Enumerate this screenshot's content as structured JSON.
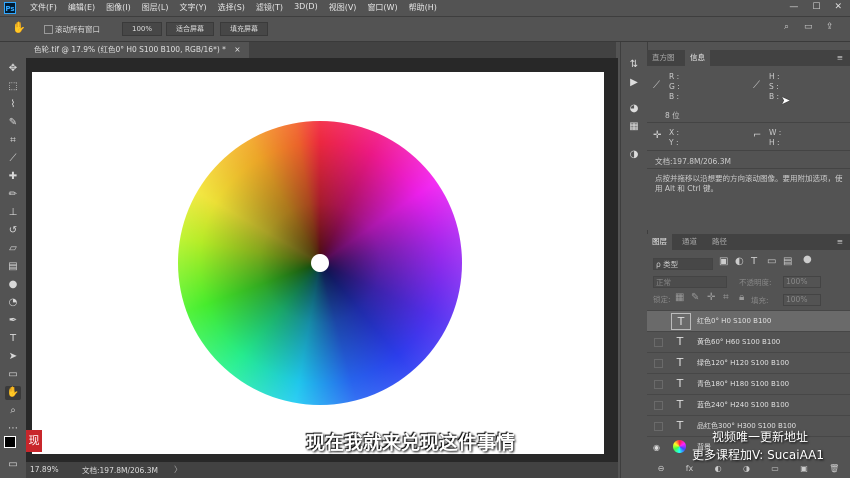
{
  "menubar": {
    "logo": "Ps",
    "items": [
      "文件(F)",
      "编辑(E)",
      "图像(I)",
      "图层(L)",
      "文字(Y)",
      "选择(S)",
      "滤镜(T)",
      "3D(D)",
      "视图(V)",
      "窗口(W)",
      "帮助(H)"
    ],
    "window_controls": [
      "—",
      "☐",
      "✕"
    ]
  },
  "options": {
    "scroll_all_label": "滚动所有窗口",
    "zoom_value": "100%",
    "fit_screen": "适合屏幕",
    "fill_screen": "填充屏幕"
  },
  "document": {
    "tab_title": "色轮.tif @ 17.9% (红色0° H0 S100 B100, RGB/16*) *",
    "tab_close": "×"
  },
  "status": {
    "zoom": "17.89%",
    "doc_size": "文档:197.8M/206.3M",
    "arrow": "〉"
  },
  "info_panel": {
    "tabs": [
      "直方图",
      "信息"
    ],
    "rgb": [
      "R :",
      "G :",
      "B :"
    ],
    "hsb": [
      "H :",
      "S :",
      "B :"
    ],
    "bits": "8 位",
    "xy": [
      "X :",
      "Y :"
    ],
    "wh": [
      "W :",
      "H :"
    ],
    "doc": "文档:197.8M/206.3M",
    "hint": "点按并拖移以沿想要的方向滚动图像。要用附加选项，使用 Alt 和 Ctrl 键。"
  },
  "layers_panel": {
    "tabs": [
      "图层",
      "通道",
      "路径"
    ],
    "filter_label": "ρ 类型",
    "blend_mode": "正常",
    "opacity_label": "不透明度:",
    "opacity_value": "100%",
    "lock_label": "锁定:",
    "fill_label": "填充:",
    "fill_value": "100%",
    "layers": [
      {
        "name": "红色0° H0 S100 B100",
        "selected": true
      },
      {
        "name": "黄色60° H60 S100 B100",
        "selected": false
      },
      {
        "name": "绿色120° H120 S100 B100",
        "selected": false
      },
      {
        "name": "青色180° H180 S100 B100",
        "selected": false
      },
      {
        "name": "蓝色240° H240 S100 B100",
        "selected": false
      },
      {
        "name": "品红色300° H300 S100 B100",
        "selected": false
      }
    ],
    "bottom_layer_name": "背景",
    "bottom_icons": [
      "⊖",
      "fx",
      "◐",
      "◑",
      "▭",
      "▣",
      "🗑"
    ]
  },
  "overlay": {
    "caption": "现在我就来兑现这件事情",
    "watermark_line1": "视频唯一更新地址",
    "watermark_line2": "更多课程加V: SucaiAA1",
    "stamp_char": "现"
  }
}
